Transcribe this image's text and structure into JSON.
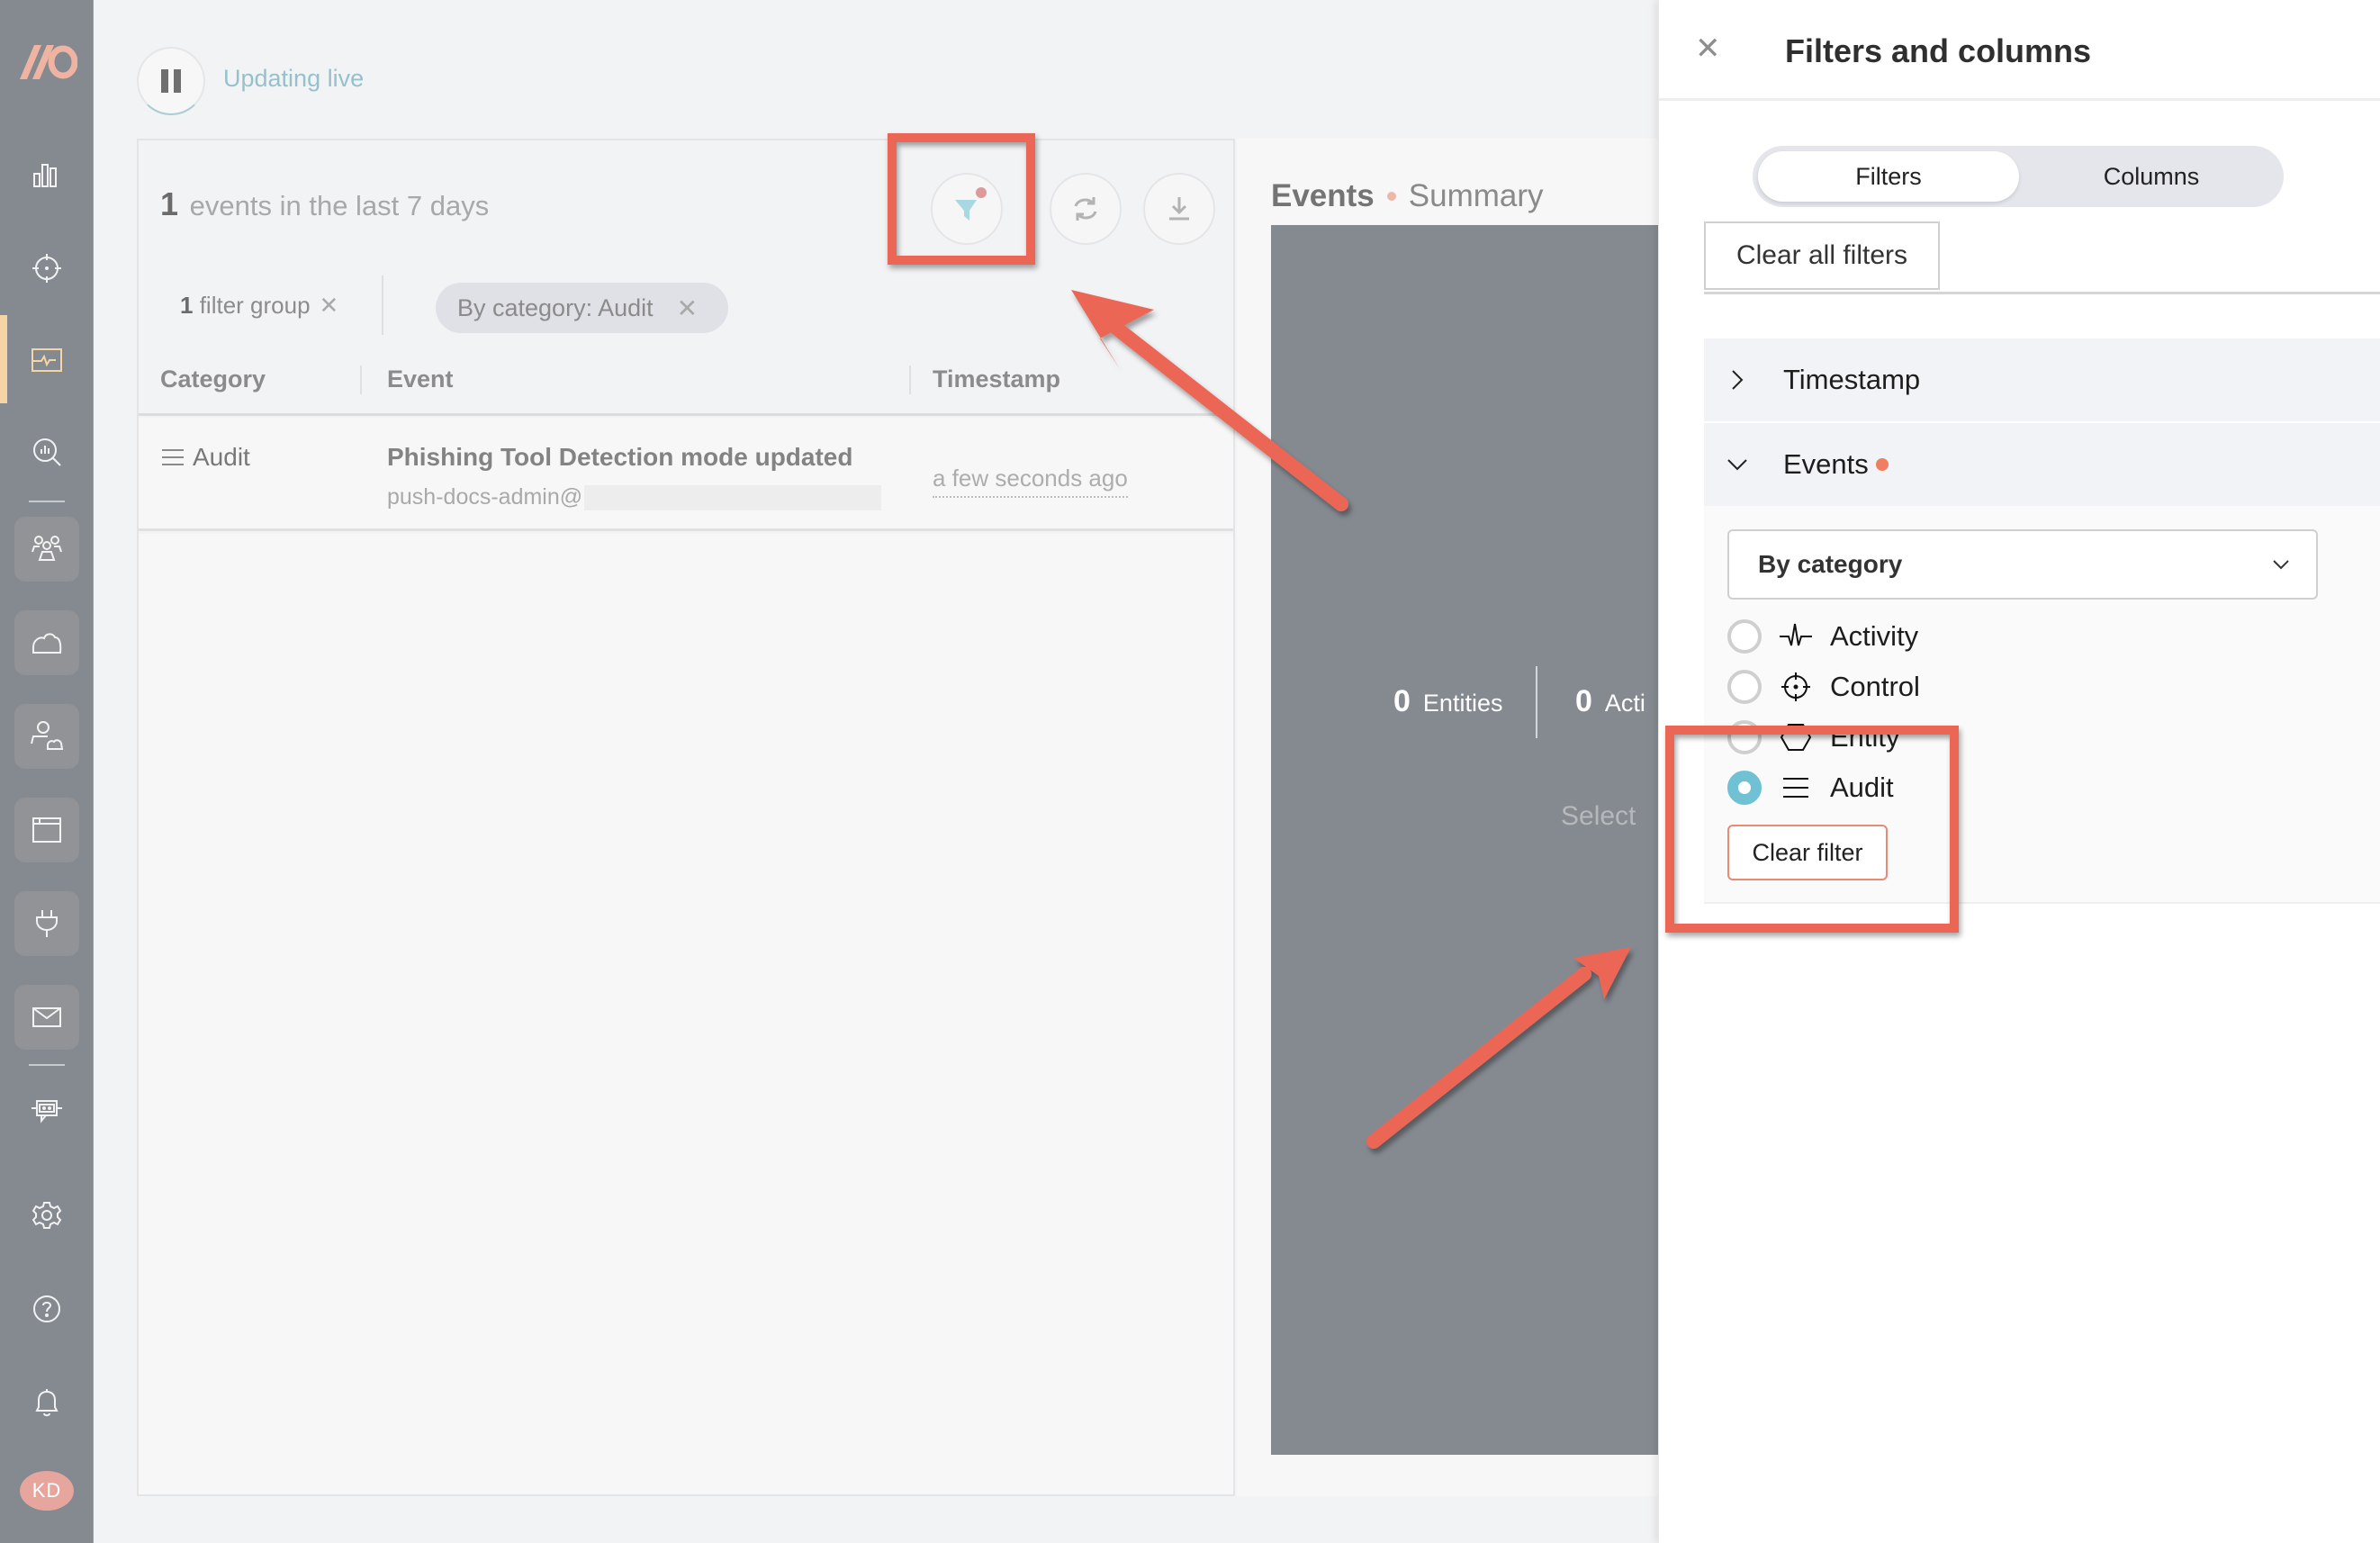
{
  "sidebar": {
    "logo": "//O",
    "items": [
      {
        "name": "dashboard",
        "icon": "bar-chart-icon"
      },
      {
        "name": "controls",
        "icon": "crosshair-icon"
      },
      {
        "name": "events",
        "icon": "activity-monitor-icon",
        "active": true
      },
      {
        "name": "search",
        "icon": "search-analytics-icon"
      },
      {
        "name": "people",
        "icon": "people-group-icon"
      },
      {
        "name": "cloud",
        "icon": "cloud-icon"
      },
      {
        "name": "user-cloud",
        "icon": "user-cloud-icon"
      },
      {
        "name": "apps",
        "icon": "browser-window-icon"
      },
      {
        "name": "integrations",
        "icon": "plug-icon"
      },
      {
        "name": "email",
        "icon": "envelope-icon"
      },
      {
        "name": "bot",
        "icon": "chat-bot-icon"
      },
      {
        "name": "settings",
        "icon": "gear-icon"
      },
      {
        "name": "help",
        "icon": "help-icon"
      },
      {
        "name": "notifications",
        "icon": "bell-icon"
      }
    ],
    "avatar_initials": "KD"
  },
  "topbar": {
    "live_status": "Updating live"
  },
  "events_list": {
    "count": "1",
    "count_suffix": "events in the last 7 days",
    "filter_group_count": "1",
    "filter_group_label": "filter group",
    "active_chip": "By category: Audit",
    "columns": [
      "Category",
      "Event",
      "Timestamp"
    ],
    "rows": [
      {
        "category": "Audit",
        "category_icon": "list-lines-icon",
        "title": "Phishing Tool Detection mode updated",
        "subtitle": "push-docs-admin@",
        "timestamp": "a few seconds ago"
      }
    ]
  },
  "summary": {
    "title": "Events",
    "subtitle": "Summary",
    "stats": [
      {
        "value": "0",
        "label": "Entities"
      },
      {
        "value": "0",
        "label": "Acti"
      }
    ],
    "hint": "Select"
  },
  "drawer": {
    "title": "Filters and columns",
    "tabs": [
      {
        "label": "Filters",
        "active": true
      },
      {
        "label": "Columns",
        "active": false
      }
    ],
    "clear_all_label": "Clear all filters",
    "sections": [
      {
        "label": "Timestamp",
        "expanded": false,
        "has_active": false
      },
      {
        "label": "Events",
        "expanded": true,
        "has_active": true
      }
    ],
    "events_filter": {
      "mode": "By category",
      "options": [
        {
          "label": "Activity",
          "icon": "activity-pulse-icon",
          "selected": false
        },
        {
          "label": "Control",
          "icon": "crosshair-icon",
          "selected": false
        },
        {
          "label": "Entity",
          "icon": "hexagon-icon",
          "selected": false
        },
        {
          "label": "Audit",
          "icon": "list-lines-icon",
          "selected": true
        }
      ],
      "clear_filter_label": "Clear filter"
    }
  },
  "colors": {
    "accent_teal": "#6fc1d3",
    "annotation_red": "#ec6656",
    "active_dot": "#ef7e62",
    "sidebar_bg": "#858a91",
    "sidebar_active": "#f5d4a5"
  }
}
